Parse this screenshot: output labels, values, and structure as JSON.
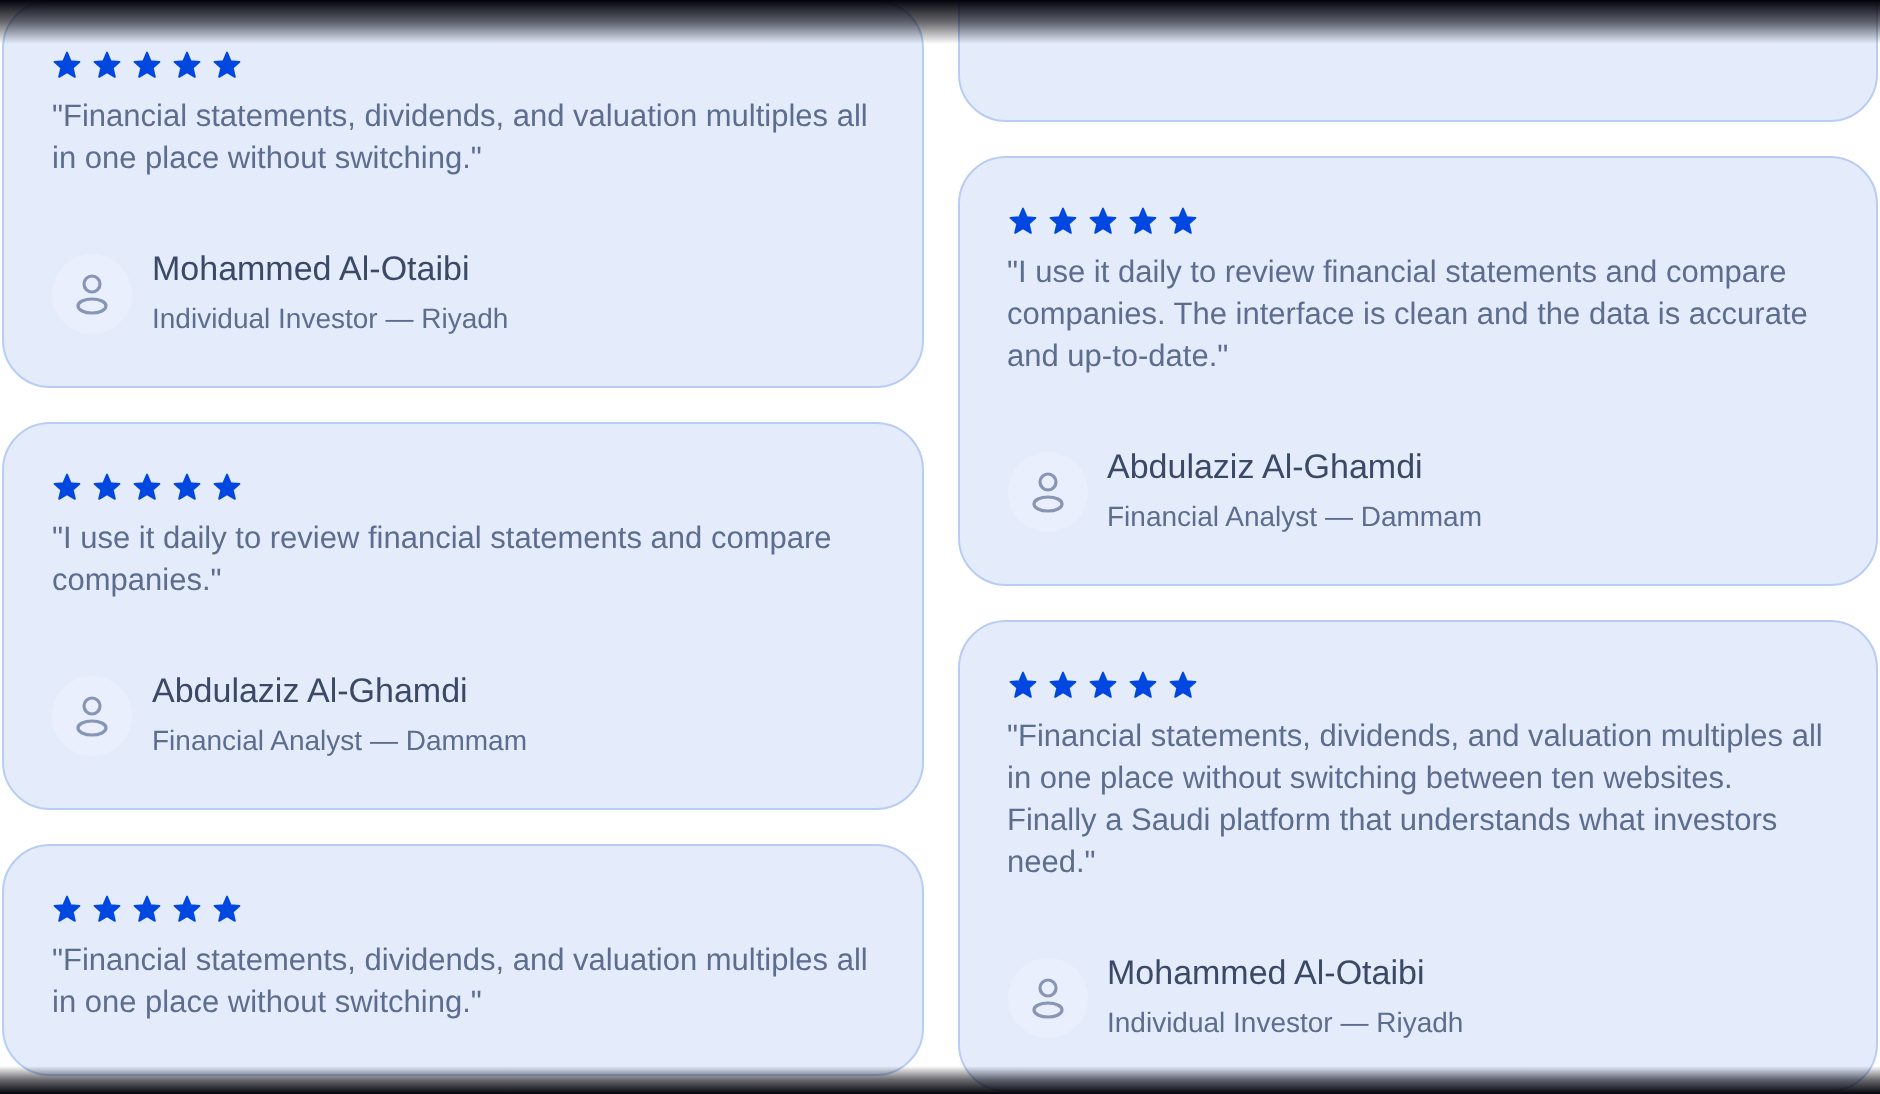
{
  "columns": [
    {
      "cards": [
        {
          "kind": "review",
          "stars": 5,
          "quote": "\"Financial statements, dividends, and valuation multiples all in one place without switching.\"",
          "name": "Mohammed Al-Otaibi",
          "role": "Individual Investor — Riyadh"
        },
        {
          "kind": "review",
          "stars": 5,
          "quote": "\"I use it daily to review financial statements and compare companies.\"",
          "name": "Abdulaziz Al-Ghamdi",
          "role": "Financial Analyst — Dammam"
        },
        {
          "kind": "review",
          "stars": 5,
          "quote": "\"Financial statements, dividends, and valuation multiples all in one place without switching.\""
        }
      ]
    },
    {
      "cards": [
        {
          "kind": "cut"
        },
        {
          "kind": "review",
          "stars": 5,
          "quote": "\"I use it daily to review financial statements and compare companies. The interface is clean and the data is accurate and up-to-date.\"",
          "name": "Abdulaziz Al-Ghamdi",
          "role": "Financial Analyst — Dammam"
        },
        {
          "kind": "review",
          "stars": 5,
          "quote": "\"Financial statements, dividends, and valuation multiples all in one place without switching between ten websites. Finally a Saudi platform that understands what investors need.\"",
          "name": "Mohammed Al-Otaibi",
          "role": "Individual Investor — Riyadh"
        }
      ]
    }
  ]
}
